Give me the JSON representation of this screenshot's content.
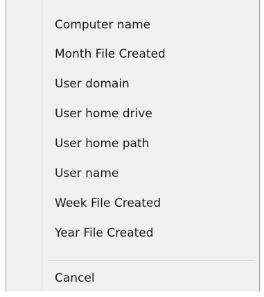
{
  "menu": {
    "items": [
      {
        "label": "Computer name"
      },
      {
        "label": "Month File Created"
      },
      {
        "label": "User domain"
      },
      {
        "label": "User home drive"
      },
      {
        "label": "User home path"
      },
      {
        "label": "User name"
      },
      {
        "label": "Week File Created"
      },
      {
        "label": "Year File Created"
      }
    ],
    "cancel_label": "Cancel"
  }
}
